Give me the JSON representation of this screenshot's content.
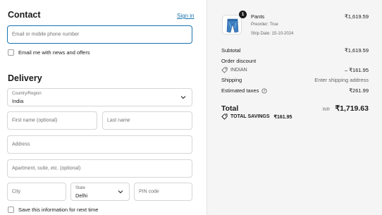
{
  "contact": {
    "title": "Contact",
    "sign_in": "Sign in",
    "email_placeholder": "Email or mobile phone number",
    "newsletter_label": "Email me with news and offers"
  },
  "delivery": {
    "title": "Delivery",
    "country_label": "Country/Region",
    "country_value": "India",
    "first_name_placeholder": "First name (optional)",
    "last_name_placeholder": "Last name",
    "address_placeholder": "Address",
    "apartment_placeholder": "Apartment, suite, etc. (optional)",
    "city_placeholder": "City",
    "state_label": "State",
    "state_value": "Delhi",
    "pin_placeholder": "PIN code",
    "save_info_label": "Save this information for next time"
  },
  "order": {
    "item": {
      "name": "Pants",
      "quantity": "1",
      "preorder": "Preorder: True",
      "ship_date": "Ship Date: 15-10-2024",
      "price": "₹1,619.59"
    },
    "subtotal_label": "Subtotal",
    "subtotal_value": "₹1,619.59",
    "discount_label": "Order discount",
    "discount_code": "INDIAN",
    "discount_value": "– ₹161.95",
    "shipping_label": "Shipping",
    "shipping_value": "Enter shipping address",
    "taxes_label": "Estimated taxes",
    "taxes_value": "₹261.99",
    "total_label": "Total",
    "currency": "INR",
    "total_value": "₹1,719.63",
    "savings_label": "TOTAL SAVINGS",
    "savings_value": "₹161.95"
  },
  "colors": {
    "accent": "#1773b0",
    "panel_bg": "#f5f5f5"
  }
}
